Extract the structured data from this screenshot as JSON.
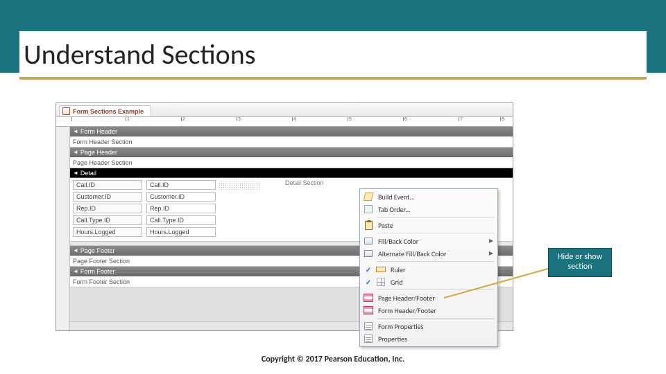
{
  "slide": {
    "title": "Understand Sections",
    "copyright": "Copyright © 2017 Pearson Education, Inc."
  },
  "callout": {
    "text": "Hide or show section"
  },
  "form": {
    "tab_title": "Form Sections Example",
    "ruler_marks": [
      "1",
      "2",
      "3",
      "4",
      "5",
      "6",
      "7",
      "8"
    ],
    "sections": {
      "form_header": {
        "bar": "Form Header",
        "label": "Form Header Section"
      },
      "page_header": {
        "bar": "Page Header",
        "label": "Page Header Section"
      },
      "detail": {
        "bar": "Detail",
        "annotation": "Detail Section"
      },
      "page_footer": {
        "bar": "Page Footer",
        "label": "Page Footer Section"
      },
      "form_footer": {
        "bar": "Form Footer",
        "label": "Form Footer Section"
      }
    },
    "fields": [
      {
        "label": "Call.ID",
        "control": "Call.ID"
      },
      {
        "label": "Customer.ID",
        "control": "Customer.ID"
      },
      {
        "label": "Rep.ID",
        "control": "Rep.ID"
      },
      {
        "label": "Call.Type.ID",
        "control": "Call.Type.ID"
      },
      {
        "label": "Hours.Logged",
        "control": "Hours.Logged"
      }
    ]
  },
  "context_menu": {
    "items": [
      {
        "icon": "build-icon",
        "label": "Build Event...",
        "has_sub": false
      },
      {
        "icon": "taborder-icon",
        "label": "Tab Order...",
        "has_sub": false
      },
      {
        "sep": true
      },
      {
        "icon": "paste-icon",
        "label": "Paste",
        "has_sub": false
      },
      {
        "sep": true
      },
      {
        "icon": "fill-icon",
        "label": "Fill/Back Color",
        "has_sub": true
      },
      {
        "icon": "altfill-icon",
        "label": "Alternate Fill/Back Color",
        "has_sub": true
      },
      {
        "sep": true
      },
      {
        "icon": "ruler-icon",
        "label": "Ruler",
        "checked": true
      },
      {
        "icon": "grid-icon",
        "label": "Grid",
        "checked": true
      },
      {
        "sep": true
      },
      {
        "icon": "pagehf-icon",
        "label": "Page Header/Footer"
      },
      {
        "icon": "formhf-icon",
        "label": "Form Header/Footer"
      },
      {
        "sep": true
      },
      {
        "icon": "formprops-icon",
        "label": "Form Properties"
      },
      {
        "icon": "props-icon",
        "label": "Properties"
      }
    ]
  }
}
